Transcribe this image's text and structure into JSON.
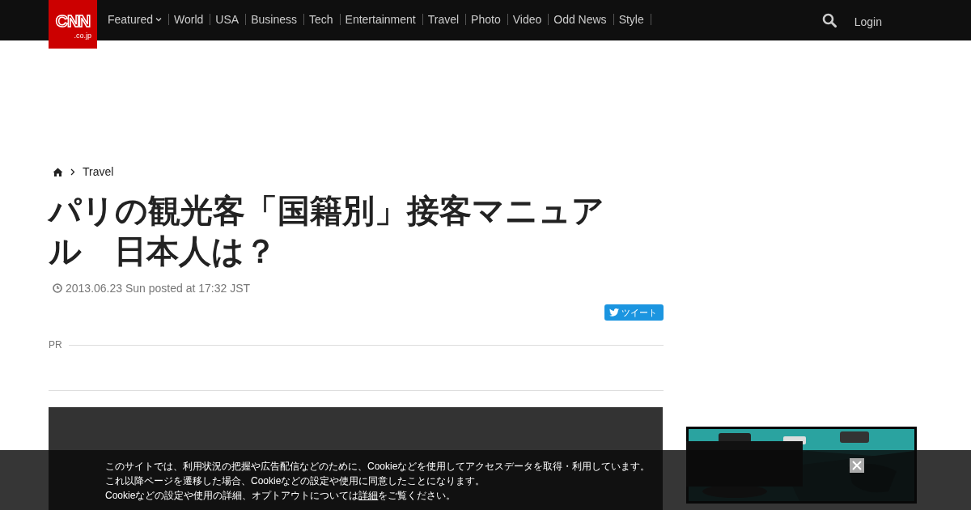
{
  "header": {
    "logo": {
      "main": "CNN",
      "sub": ".co.jp"
    },
    "nav": [
      {
        "label": "Featured",
        "kind": "dropdown"
      },
      {
        "label": "World",
        "kind": "link"
      },
      {
        "label": "USA",
        "kind": "link"
      },
      {
        "label": "Business",
        "kind": "link"
      },
      {
        "label": "Tech",
        "kind": "link"
      },
      {
        "label": "Entertainment",
        "kind": "link"
      },
      {
        "label": "Travel",
        "kind": "link"
      },
      {
        "label": "Photo",
        "kind": "link"
      },
      {
        "label": "Video",
        "kind": "link"
      },
      {
        "label": "Odd News",
        "kind": "link"
      },
      {
        "label": "Style",
        "kind": "link"
      }
    ],
    "login": "Login"
  },
  "breadcrumb": {
    "current": "Travel"
  },
  "article": {
    "title": "パリの観光客「国籍別」接客マニュアル　日本人は？",
    "date": "2013.06.23 Sun posted at 17:32 JST",
    "tweet_button": "ツイート",
    "pr_label": "PR"
  },
  "cookie_notice": {
    "lines": [
      "このサイトでは、利用状況の把握や広告配信などのために、Cookieなどを使用してアクセスデータを取得・利用しています。",
      "これ以降ページを遷移した場合、Cookieなどの設定や使用に同意したことになります。"
    ],
    "last_line_before": "Cookieなどの設定や使用の詳細、オプトアウトについては",
    "link": "詳細",
    "last_line_after": "をご覧ください。"
  }
}
